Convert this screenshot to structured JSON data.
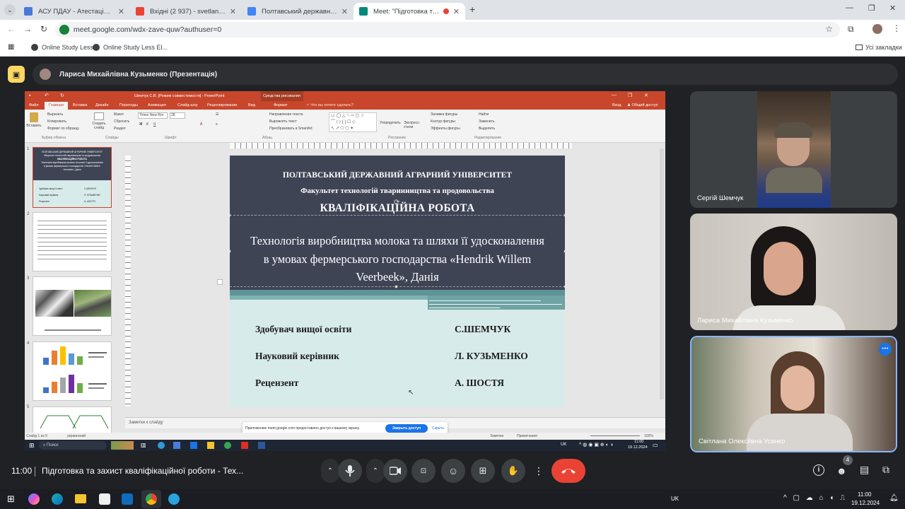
{
  "browser": {
    "tabs": [
      {
        "title": "АСУ ПДАУ - Атестація за семестр",
        "color": "#4a79d8"
      },
      {
        "title": "Вхідні (2 937) - svetlana.usenko",
        "color": "#ea4335"
      },
      {
        "title": "Полтавський державний аграр",
        "color": "#4285f4"
      },
      {
        "title": "Meet: \"Підготовка та захи",
        "color": "#00897b"
      }
    ],
    "url": "meet.google.com/wdx-zave-quw?authuser=0",
    "bookmarks": [
      "Online Study Less",
      "Online Study Less El..."
    ],
    "all_bookmarks": "Усі закладки"
  },
  "meet": {
    "presenter_label": "Лариса Михайлівна Кузьменко (Презентація)",
    "time": "11:00",
    "meeting_title": "Підготовка та захист кваліфікаційної роботи - Тех...",
    "participants_count": "4",
    "participants": [
      {
        "name": "Сергій Шемчук"
      },
      {
        "name": "Лариса Михайлівна Кузьменко"
      },
      {
        "name": "Світлана Олексіївна Усенко"
      }
    ],
    "more_icon": "⋯"
  },
  "ppt": {
    "title": "Шемчук С.В. [Режим совместимости] - PowerPoint",
    "context_tab": "Средства рисования",
    "menu_tabs": [
      "Файл",
      "Главная",
      "Вставка",
      "Дизайн",
      "Переходы",
      "Анимация",
      "Слайд-шоу",
      "Рецензирование",
      "Вид",
      "Формат"
    ],
    "tell_me": "Что вы хотите сделать?",
    "sign_in": "Вход",
    "share": "Общий доступ",
    "ribbon_groups": [
      "Буфер обмена",
      "Слайды",
      "Шрифт",
      "Абзац",
      "Рисование",
      "Редактирование"
    ],
    "ribbon_buttons": {
      "paste": "Вставить",
      "cut": "Вырезать",
      "copy": "Копировать",
      "format_painter": "Формат по образцу",
      "new_slide": "Создать слайд",
      "layout": "Макет",
      "reset": "Сбросить",
      "section": "Раздел",
      "font": "Times New Ror",
      "size": "28",
      "text_dir": "Направление текста",
      "align_text": "Выровнять текст",
      "smartart": "Преобразовать в SmartArt",
      "arrange": "Упорядочить",
      "quick_styles": "Экспресс-стили",
      "fill": "Заливка фигуры",
      "outline": "Контур фигуры",
      "effects": "Эффекты фигуры",
      "find": "Найти",
      "replace": "Заменить",
      "select": "Выделить"
    },
    "notes_placeholder": "Заметки к слайду",
    "status_left": "Слайд 1 из 9",
    "status_lang": "украинский",
    "status_notes": "Заметки",
    "status_comments": "Примечания",
    "zoom": "105%",
    "share_notice": "Приложению meet.google.com предоставлен доступ к вашему экрану.",
    "share_stop": "Закрыть доступ",
    "share_hide": "Скрыть",
    "search_placeholder": "Поиск",
    "win_lang": "UK",
    "win_time": "11:00",
    "win_date": "19.12.2024"
  },
  "slide": {
    "university": "ПОЛТАВСЬКИЙ ДЕРЖАВНИЙ АГРАРНИЙ УНІВЕРСИТЕТ",
    "faculty": "Факультет технологій тваринництва та продовольства",
    "work_type": "КВАЛІФІКАЦІЙНА РОБОТА",
    "topic_line1": "Технологія виробництва молока та шляхи її удосконалення",
    "topic_line2": "в умовах фермерського господарства «Hendrik Willem",
    "topic_line3": "Veerbeek», Данія",
    "roles": [
      {
        "role": "Здобувач вищої освіти",
        "person": "С.ШЕМЧУК"
      },
      {
        "role": "Науковий керівник",
        "person": "Л. КУЗЬМЕНКО"
      },
      {
        "role": "Рецензент",
        "person": "А. ШОСТЯ"
      }
    ]
  },
  "thumbnails": {
    "numbers": [
      "1",
      "2",
      "3",
      "4",
      "5"
    ],
    "slide1_lines": [
      "ПОЛТАВСЬКИЙ ДЕРЖАВНИЙ АГРАРНИЙ УНІВЕРСИТЕТ",
      "Факультет технологій тваринництва та продовольства",
      "КВАЛІФІКАЦІЙНА РОБОТА",
      "Технологія виробництва молока та шляхи її удосконалення",
      "в умовах фермерського господарства «Hendrik Willem",
      "Veerbeek», Данія"
    ],
    "slide1_roles": [
      "Здобувач вищої освіти",
      "Науковий керівник",
      "Рецензент"
    ],
    "slide1_persons": [
      "С.ШЕМЧУК",
      "Л. КУЗЬМЕНКО",
      "А. ШОСТЯ"
    ]
  },
  "taskbar": {
    "lang": "UK",
    "time": "11:00",
    "date": "19.12.2024"
  },
  "colors": {
    "meet_bg": "#202124",
    "end_call": "#ea4335",
    "ppt_red": "#c8462b",
    "slide_dark": "#3f4455",
    "slide_light": "#d7ebea",
    "active_speaker": "#8ab4f8"
  }
}
